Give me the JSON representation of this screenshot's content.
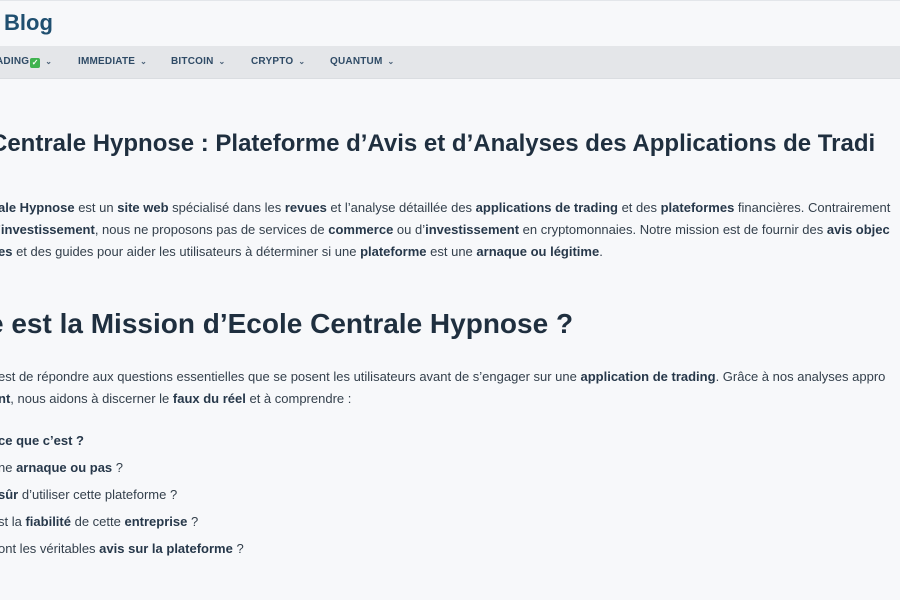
{
  "header": {
    "site_title": "Blog"
  },
  "nav": {
    "items": [
      {
        "label": "ADING",
        "has_check": true
      },
      {
        "label": "IMMEDIATE"
      },
      {
        "label": "BITCOIN"
      },
      {
        "label": "CRYPTO"
      },
      {
        "label": "QUANTUM"
      }
    ],
    "check_glyph": "✓",
    "chevron_glyph": "⌄"
  },
  "article": {
    "h1": "Centrale Hypnose : Plateforme d’Avis et d’Analyses des Applications de Tradi",
    "intro": {
      "line1": [
        {
          "t": "ale Hypnose",
          "b": true
        },
        {
          "t": " est un "
        },
        {
          "t": "site web",
          "b": true
        },
        {
          "t": " spécialisé dans les "
        },
        {
          "t": "revues",
          "b": true
        },
        {
          "t": " et l’analyse détaillée des "
        },
        {
          "t": "applications de trading",
          "b": true
        },
        {
          "t": " et des "
        },
        {
          "t": "plateformes",
          "b": true
        },
        {
          "t": " financières. Contrairement"
        }
      ],
      "line2": [
        {
          "t": "’"
        },
        {
          "t": "investissement",
          "b": true
        },
        {
          "t": ", nous ne proposons pas de services de "
        },
        {
          "t": "commerce",
          "b": true
        },
        {
          "t": " ou d’"
        },
        {
          "t": "investissement",
          "b": true
        },
        {
          "t": " en cryptomonnaies. Notre mission est de fournir des "
        },
        {
          "t": "avis objec",
          "b": true
        }
      ],
      "line3": [
        {
          "t": "es",
          "b": true
        },
        {
          "t": " et des guides pour aider les utilisateurs à déterminer si une "
        },
        {
          "t": "plateforme",
          "b": true
        },
        {
          "t": " est une "
        },
        {
          "t": "arnaque ou légitime",
          "b": true
        },
        {
          "t": "."
        }
      ]
    },
    "h2": "e est la Mission d’Ecole Centrale Hypnose ?",
    "mission": {
      "line1": [
        {
          "t": " est de répondre aux questions essentielles que se posent les utilisateurs avant de s’engager sur une "
        },
        {
          "t": "application de trading",
          "b": true
        },
        {
          "t": ". Grâce à nos analyses appro"
        }
      ],
      "line2": [
        {
          "t": "nt",
          "b": true
        },
        {
          "t": ", nous aidons à discerner le "
        },
        {
          "t": "faux du réel",
          "b": true
        },
        {
          "t": " et à comprendre :"
        }
      ]
    },
    "questions": [
      [
        {
          "t": "ce que c’est ?",
          "b": true
        }
      ],
      [
        {
          "t": "ne "
        },
        {
          "t": "arnaque ou pas",
          "b": true
        },
        {
          "t": " ?"
        }
      ],
      [
        {
          "t": "sûr",
          "b": true
        },
        {
          "t": " d’utiliser cette plateforme ?"
        }
      ],
      [
        {
          "t": "st la "
        },
        {
          "t": "fiabilité",
          "b": true
        },
        {
          "t": " de cette "
        },
        {
          "t": "entreprise",
          "b": true
        },
        {
          "t": " ?"
        }
      ],
      [
        {
          "t": "ont les véritables "
        },
        {
          "t": "avis sur la plateforme",
          "b": true
        },
        {
          "t": " ?"
        }
      ]
    ]
  }
}
